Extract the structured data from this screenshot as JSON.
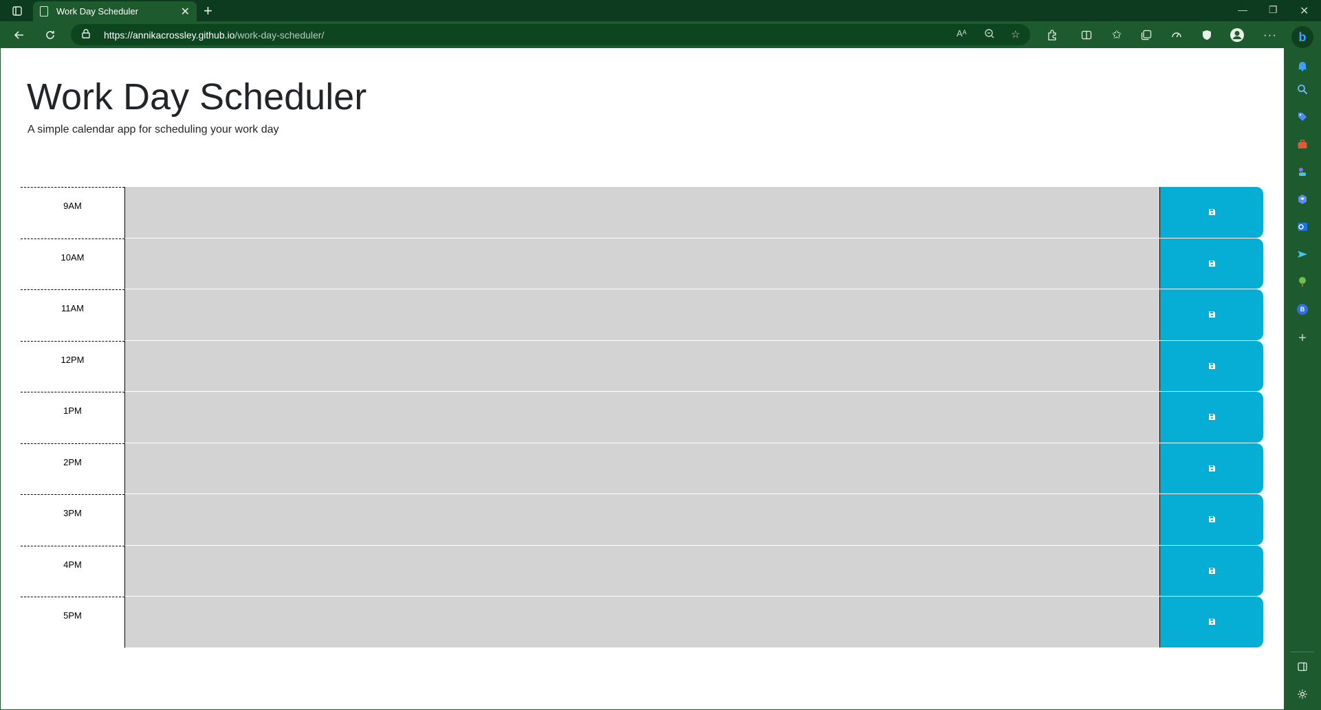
{
  "browser": {
    "tab_title": "Work Day Scheduler",
    "new_tab_symbol": "+",
    "url_host": "https://annikacrossley.github.io",
    "url_path": "/work-day-scheduler/",
    "sidebar_bing_letter": "b",
    "sidebar_profile_letter": "B"
  },
  "page": {
    "title": "Work Day Scheduler",
    "subtitle": "A simple calendar app for scheduling your work day"
  },
  "schedule": {
    "hours": [
      "9AM",
      "10AM",
      "11AM",
      "12PM",
      "1PM",
      "2PM",
      "3PM",
      "4PM",
      "5PM"
    ],
    "save_icon": "save-icon",
    "colors": {
      "past": "#d3d3d3",
      "save_button": "#06aed5"
    }
  }
}
